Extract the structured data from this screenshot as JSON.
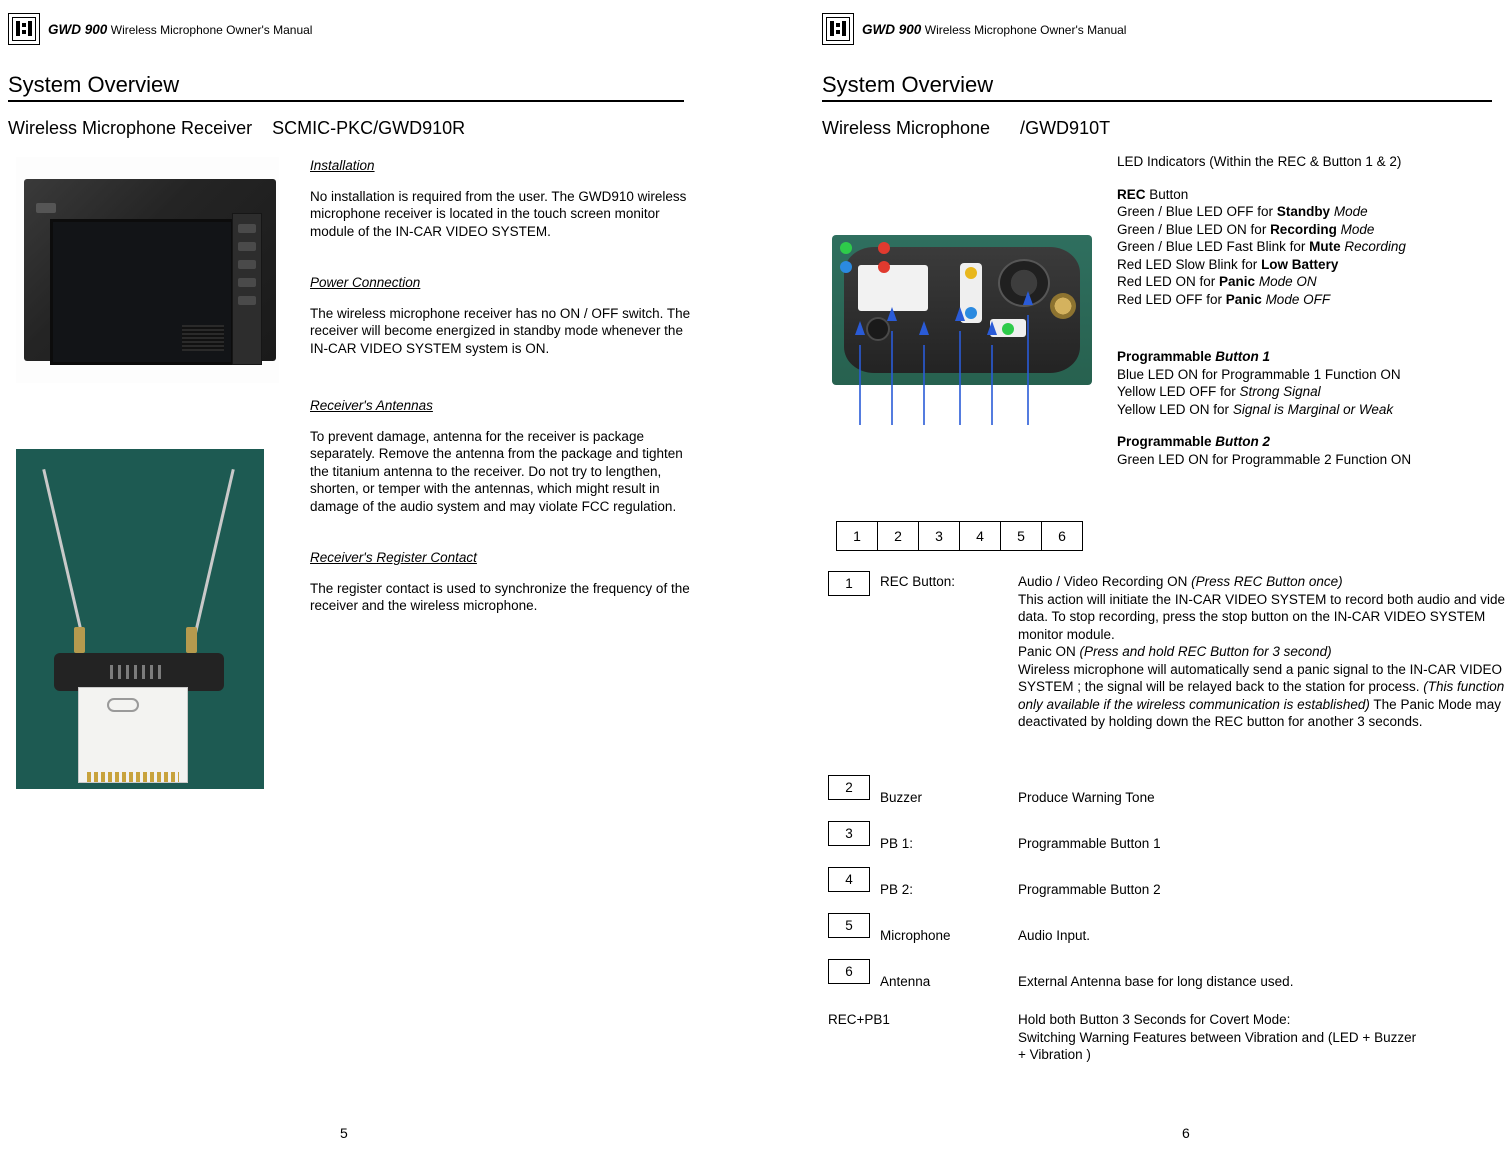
{
  "left": {
    "header": {
      "model": "GWD 900",
      "rest": "Wireless Microphone Owner's Manual",
      "logo_icon": "device-logo-icon"
    },
    "section_title": "System Overview",
    "subhead": "Wireless Microphone Receiver    SCMIC-PKC/GWD910R",
    "blocks": [
      {
        "heading": "Installation",
        "text": "No installation is required from the user.  The GWD910 wireless microphone receiver is located in the touch screen monitor module of the IN-CAR VIDEO SYSTEM."
      },
      {
        "heading": "Power Connection",
        "text": "The wireless microphone receiver has no ON / OFF switch.  The receiver will become energized in standby mode  whenever the  IN-CAR VIDEO SYSTEM system is ON."
      },
      {
        "heading": "Receiver's Antennas",
        "text": "To prevent damage, antenna for the receiver is package separately.  Remove the antenna from the package and tighten the titanium antenna to the receiver.   Do not try to lengthen, shorten, or temper with the antennas, which might result in damage of the audio system and may violate FCC regulation."
      },
      {
        "heading": "Receiver's Register Contact",
        "text": "The register contact is used to synchronize the frequency of the receiver and the wireless microphone."
      }
    ],
    "photos": [
      {
        "name": "receiver-monitor-photo",
        "alt": "In-car video monitor module photo"
      },
      {
        "name": "receiver-antenna-photo",
        "alt": "Receiver antennas and register card photo"
      }
    ],
    "page_number": "5"
  },
  "right": {
    "header": {
      "model": "GWD 900",
      "rest": "Wireless Microphone Owner's Manual",
      "logo_icon": "device-logo-icon"
    },
    "section_title": "System Overview",
    "subhead": "Wireless Microphone      /GWD910T",
    "photo": {
      "name": "wireless-microphone-photo",
      "alt": "Wireless microphone transmitter front photo"
    },
    "callout_numbers": [
      "1",
      "2",
      "3",
      "4",
      "5",
      "6"
    ],
    "led_block": {
      "title": "LED Indicators (Within the REC & Button 1 & 2)",
      "rec_title_bold": "REC",
      "rec_title_rest": " Button",
      "rec_lines": [
        {
          "plain": "Green / Blue LED OFF for ",
          "bold": "Standby",
          "italic": " Mode"
        },
        {
          "plain": "Green / Blue LED ON for ",
          "bold": "Recording",
          "italic": " Mode"
        },
        {
          "plain": "Green / Blue LED Fast Blink for ",
          "bold": "Mute",
          "italic": " Recording"
        },
        {
          "plain": "Red  LED Slow Blink for ",
          "bold": "Low Battery",
          "italic": ""
        },
        {
          "plain": "Red LED ON for ",
          "bold": "Panic",
          "italic": " Mode ON"
        },
        {
          "plain": "Red LED OFF for ",
          "bold": "Panic",
          "italic": " Mode OFF"
        }
      ],
      "pb1_title_bold": "Programmable ",
      "pb1_title_italic": "Button 1",
      "pb1_lines": [
        {
          "plain": "Blue LED ON for Programmable 1 Function ON",
          "italic": ""
        },
        {
          "plain": "Yellow LED OFF for ",
          "italic": "Strong Signal"
        },
        {
          "plain": "Yellow LED ON for ",
          "italic": "Signal is Marginal or Weak"
        }
      ],
      "pb2_title_bold": "Programmable ",
      "pb2_title_italic": "Button 2",
      "pb2_lines": [
        {
          "plain": "Green LED ON for Programmable 2 Function ON",
          "italic": ""
        }
      ]
    },
    "rows": [
      {
        "tag": "1",
        "label": "REC Button:",
        "desc_parts": [
          {
            "t": "Audio / Video Recording ON  ",
            "s": "normal"
          },
          {
            "t": "(Press REC Button once)",
            "s": "italic"
          },
          {
            "t": "\nThis action will initiate the IN-CAR VIDEO SYSTEM to record both audio and video data.  To stop recording, press the stop button on the IN-CAR VIDEO SYSTEM monitor module.\nPanic ON  ",
            "s": "normal"
          },
          {
            "t": "(Press and hold REC Button for 3 second)",
            "s": "italic"
          },
          {
            "t": "\nWireless microphone will automatically send a panic signal to the IN-CAR VIDEO SYSTEM ; the signal will be relayed back to the station for process. ",
            "s": "normal"
          },
          {
            "t": "(This function is only available if the wireless communication is established)",
            "s": "italic"
          },
          {
            "t": "  The Panic Mode may be deactivated by holding down the REC button  for another 3 seconds.",
            "s": "normal"
          }
        ]
      },
      {
        "tag": "2",
        "label": "Buzzer",
        "desc": "Produce Warning Tone"
      },
      {
        "tag": "3",
        "label": "PB 1:",
        "desc": "Programmable Button 1"
      },
      {
        "tag": "4",
        "label": "PB 2:",
        "desc": "Programmable Button 2"
      },
      {
        "tag": "5",
        "label": "Microphone",
        "desc": "Audio Input."
      },
      {
        "tag": "6",
        "label": "Antenna",
        "desc": "External Antenna base for long distance used."
      },
      {
        "tag": "",
        "label": "REC+PB1",
        "desc": "Hold both Button  3 Seconds for Covert Mode:\nSwitching Warning Features between Vibration and (LED + Buzzer\n        + Vibration )"
      }
    ],
    "page_number": "6"
  }
}
